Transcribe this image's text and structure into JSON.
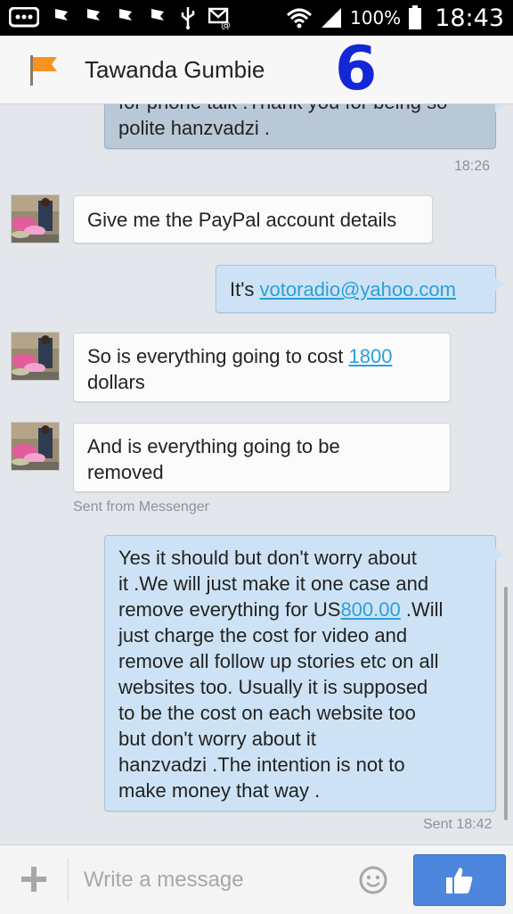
{
  "status_bar": {
    "battery_percent": "100%",
    "time": "18:43",
    "icons": [
      "bbm-icon",
      "flag-notif-icon",
      "flag-notif-icon",
      "flag-notif-icon",
      "flag-notif-icon",
      "usb-icon",
      "mail-icon",
      "wifi-icon",
      "signal-icon",
      "battery-icon"
    ]
  },
  "header": {
    "contact_name": "Tawanda Gumbie",
    "overlay_number": "6",
    "flag_color": "#f7931e"
  },
  "messages": [
    {
      "direction": "out",
      "partial_top_text": "for phone talk .Thank you for being so",
      "text": "polite hanzvadzi ."
    },
    {
      "type": "time",
      "text": "18:26"
    },
    {
      "direction": "in",
      "text": "Give me the PayPal account details"
    },
    {
      "direction": "out",
      "text_prefix": "It's ",
      "link": "votoradio@yahoo.com"
    },
    {
      "direction": "in",
      "line1_prefix": "So is everything going to cost ",
      "link": "1800",
      "line2": "dollars"
    },
    {
      "direction": "in",
      "line1": "And is everything going to be",
      "line2": "removed"
    },
    {
      "type": "meta",
      "text": "Sent from Messenger"
    },
    {
      "direction": "out",
      "lines": [
        "Yes it should but don't worry about",
        "it .We will just make it one case and",
        "remove everything for US",
        " .Will",
        "just charge the cost for video and",
        "remove all follow up stories etc on all",
        "websites too. Usually it is supposed",
        "to be the cost on each website too",
        "but don't worry about it",
        "hanzvadzi .The intention is not to",
        "make money that way ."
      ],
      "link": "800.00"
    },
    {
      "type": "meta",
      "text": "Sent 18:42"
    }
  ],
  "composer": {
    "placeholder": "Write a message",
    "icons": [
      "plus-icon",
      "emoji-icon",
      "thumbs-up-icon"
    ],
    "like_color": "#4d87dd"
  }
}
